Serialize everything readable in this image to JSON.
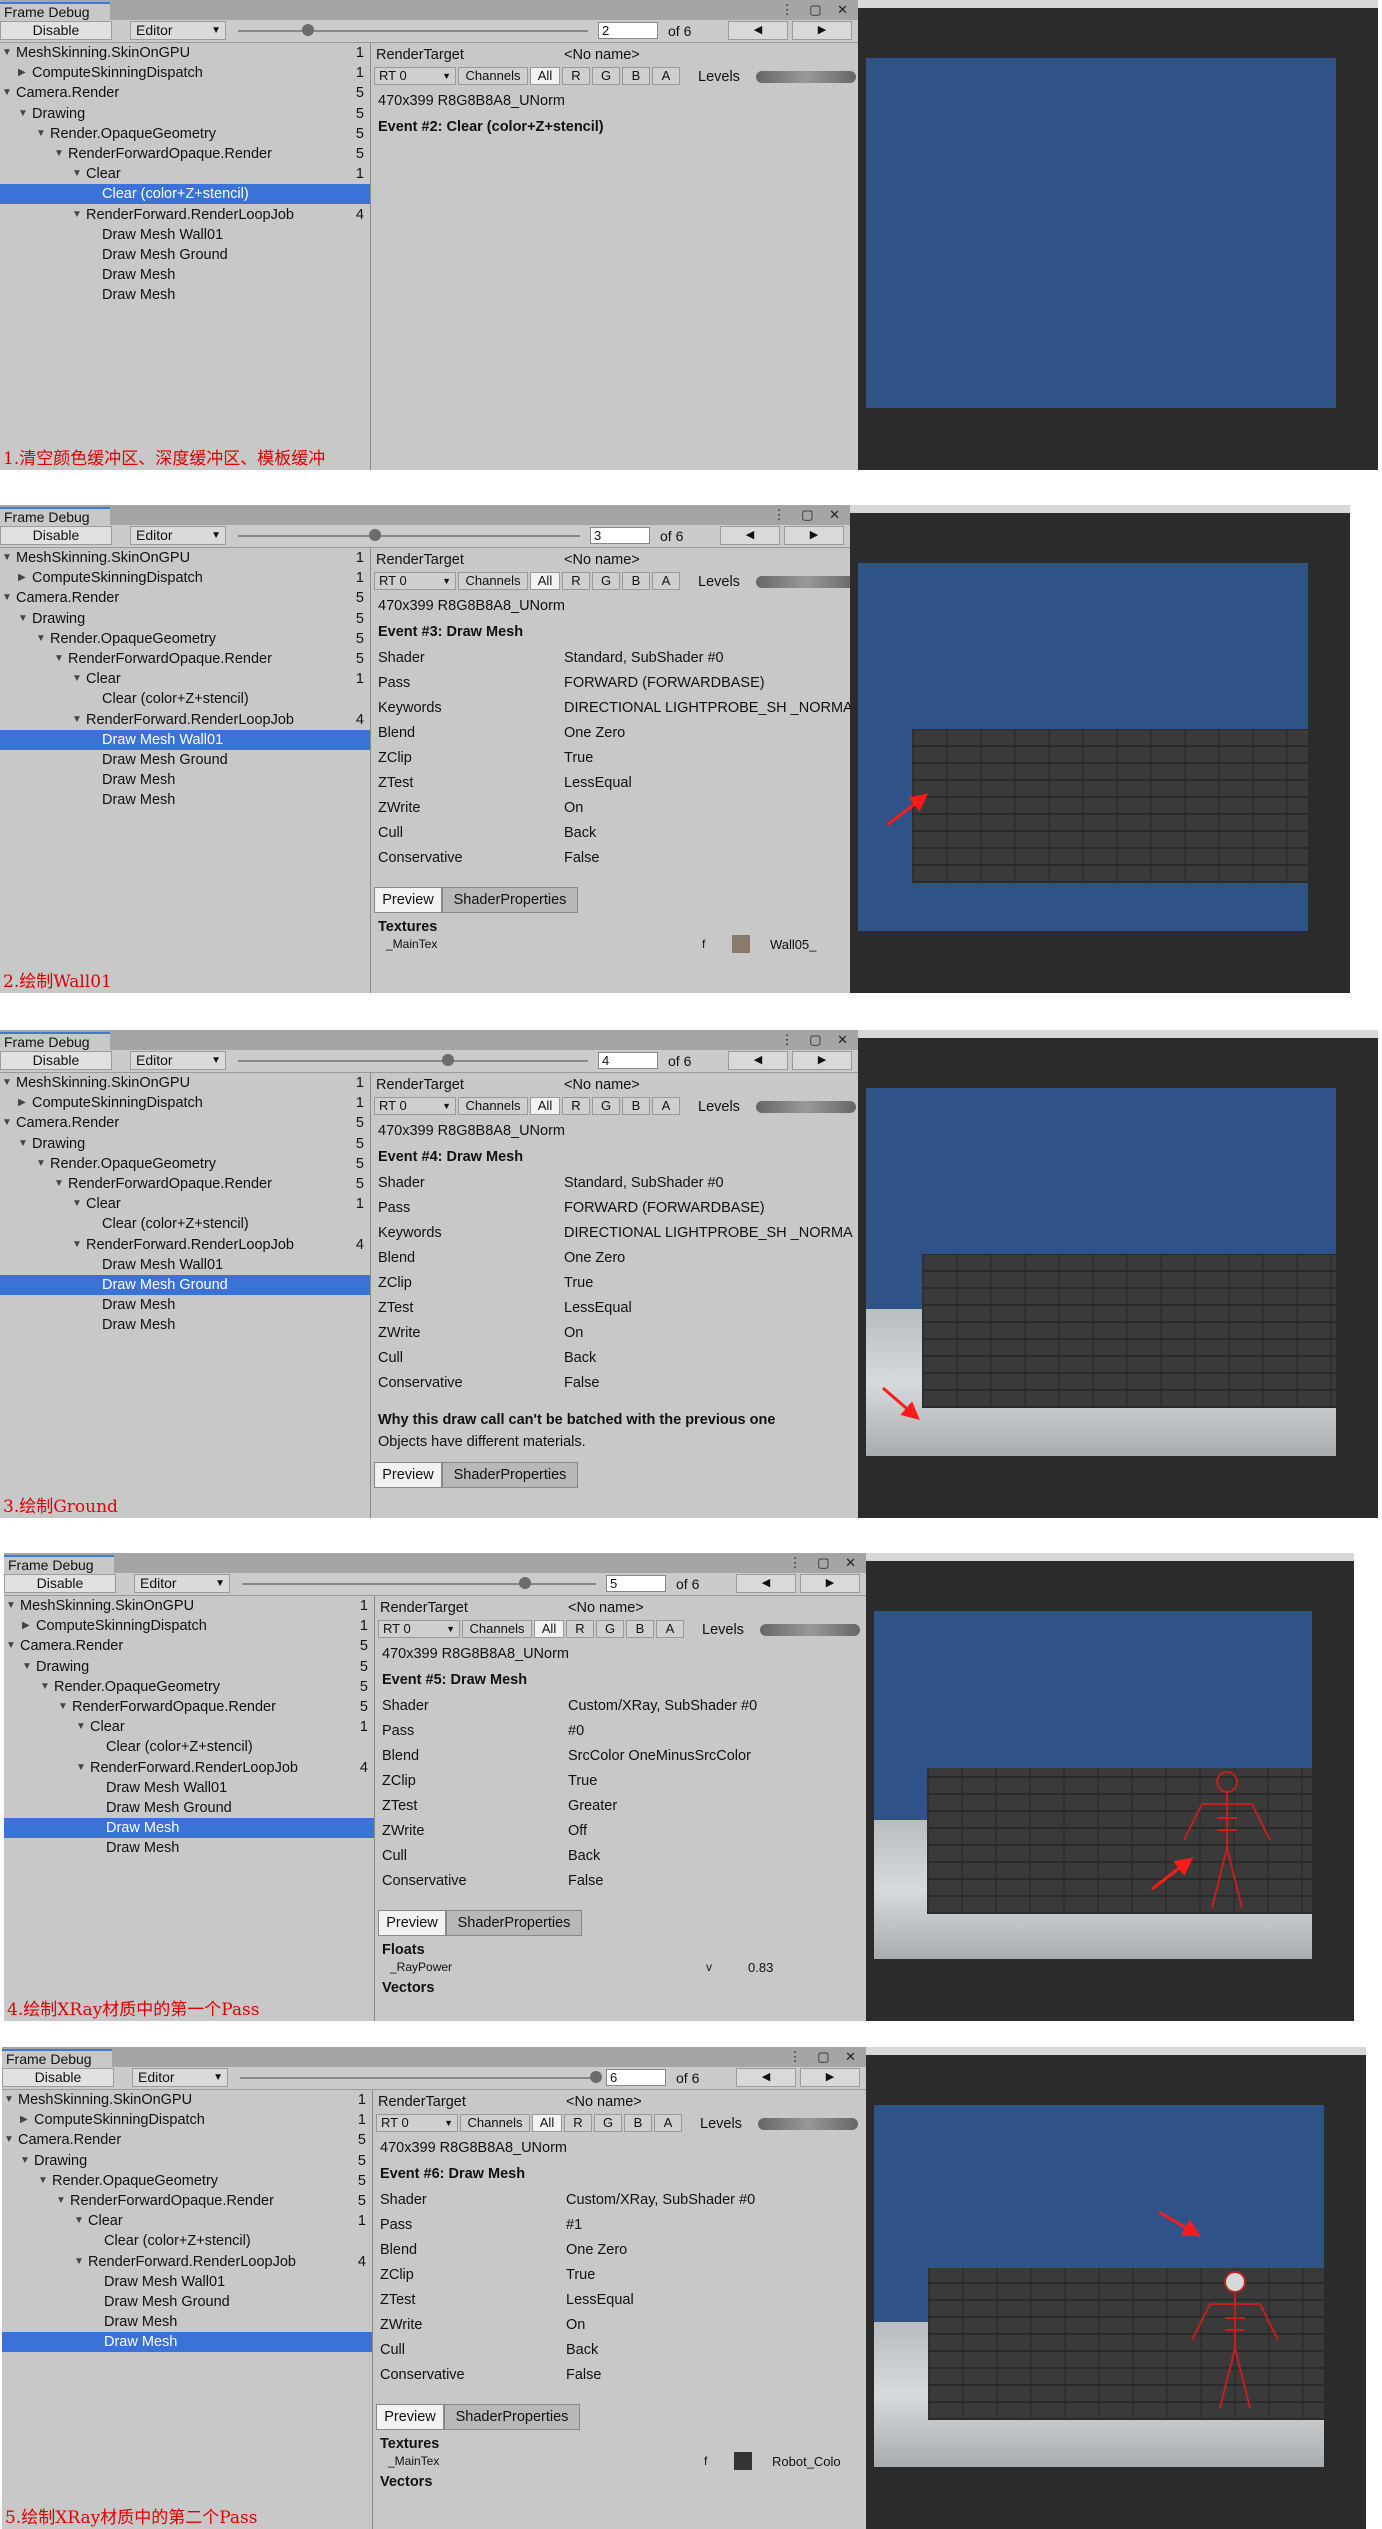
{
  "window": {
    "title": "Frame Debug",
    "disable_label": "Disable",
    "editor_label": "Editor",
    "of_label": "of 6",
    "render_target_label": "RenderTarget",
    "render_target_value": "<No name>",
    "rt_label": "RT 0",
    "channels_label": "Channels",
    "channel_all": "All",
    "channel_r": "R",
    "channel_g": "G",
    "channel_b": "B",
    "channel_a": "A",
    "levels_label": "Levels",
    "format_text": "470x399 R8G8B8A8_UNorm",
    "preview_tab": "Preview",
    "shader_props_tab": "ShaderProperties"
  },
  "tree_labels": {
    "mesh_skinning": "MeshSkinning.SkinOnGPU",
    "compute_skinning": "ComputeSkinningDispatch",
    "camera_render": "Camera.Render",
    "drawing": "Drawing",
    "opaque_geometry": "Render.OpaqueGeometry",
    "forward_opaque": "RenderForwardOpaque.Render",
    "clear": "Clear",
    "clear_event": "Clear (color+Z+stencil)",
    "loop_job": "RenderForward.RenderLoopJob",
    "draw_wall": "Draw Mesh Wall01",
    "draw_ground": "Draw Mesh Ground",
    "draw_mesh": "Draw Mesh",
    "count_1": "1",
    "count_4": "4",
    "count_5": "5"
  },
  "detail_labels": {
    "shader": "Shader",
    "pass": "Pass",
    "keywords": "Keywords",
    "blend": "Blend",
    "zclip": "ZClip",
    "ztest": "ZTest",
    "zwrite": "ZWrite",
    "cull": "Cull",
    "conservative": "Conservative"
  },
  "panels": [
    {
      "frame": "2",
      "event_title": "Event #2: Clear (color+Z+stencil)",
      "caption": "1.清空颜色缓冲区、深度缓冲区、模板缓冲"
    },
    {
      "frame": "3",
      "event_title": "Event #3: Draw Mesh",
      "shader": "Standard, SubShader #0",
      "pass": "FORWARD (FORWARDBASE)",
      "keywords": "DIRECTIONAL LIGHTPROBE_SH _NORMA",
      "blend": "One Zero",
      "zclip": "True",
      "ztest": "LessEqual",
      "zwrite": "On",
      "cull": "Back",
      "conservative": "False",
      "section": "Textures",
      "prop_name": "_MainTex",
      "prop_type": "f",
      "prop_value": "Wall05_",
      "caption": "2.绘制Wall01"
    },
    {
      "frame": "4",
      "event_title": "Event #4: Draw Mesh",
      "shader": "Standard, SubShader #0",
      "pass": "FORWARD (FORWARDBASE)",
      "keywords": "DIRECTIONAL LIGHTPROBE_SH _NORMA",
      "blend": "One Zero",
      "zclip": "True",
      "ztest": "LessEqual",
      "zwrite": "On",
      "cull": "Back",
      "conservative": "False",
      "batch_title": "Why this draw call can't be batched with the previous one",
      "batch_reason": "Objects have different materials.",
      "caption": "3.绘制Ground"
    },
    {
      "frame": "5",
      "event_title": "Event #5: Draw Mesh",
      "shader": "Custom/XRay, SubShader #0",
      "pass": "#0",
      "blend": "SrcColor OneMinusSrcColor",
      "zclip": "True",
      "ztest": "Greater",
      "zwrite": "Off",
      "cull": "Back",
      "conservative": "False",
      "section": "Floats",
      "prop_name": "_RayPower",
      "prop_type": "v",
      "prop_value": "0.83",
      "section2": "Vectors",
      "caption": "4.绘制XRay材质中的第一个Pass"
    },
    {
      "frame": "6",
      "event_title": "Event #6: Draw Mesh",
      "shader": "Custom/XRay, SubShader #0",
      "pass": "#1",
      "blend": "One Zero",
      "zclip": "True",
      "ztest": "LessEqual",
      "zwrite": "On",
      "cull": "Back",
      "conservative": "False",
      "section": "Textures",
      "prop_name": "_MainTex",
      "prop_type": "f",
      "prop_value": "Robot_Colo",
      "section2": "Vectors",
      "caption": "5.绘制XRay材质中的第二个Pass"
    }
  ],
  "colors": {
    "selection": "#3a72d8",
    "caption": "#e00000",
    "sky": "#2f5288",
    "panel_bg": "#c8c8c8"
  }
}
